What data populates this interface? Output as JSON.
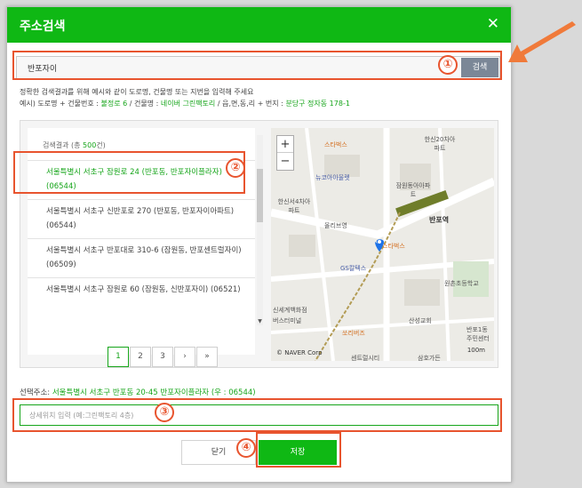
{
  "header": {
    "title": "주소검색",
    "close_label": "✕"
  },
  "search": {
    "value": "반포자이",
    "button_label": "검색"
  },
  "hints": {
    "line1": "정확한 검색결과를 위해 예시와 같이 도로명, 건물명 또는 지번을 입력해 주세요",
    "line2_prefix": "예시) 도로명 + 건물번호 : ",
    "line2_ex1": "불정로 6",
    "line2_mid1": " / 건물명 : ",
    "line2_ex2": "네이버 그린팩토리",
    "line2_mid2": " / 읍,면,동,리 + 번지 : ",
    "line2_ex3": "분당구 정자동 178-1"
  },
  "results": {
    "count_prefix": "검색결과 (총 ",
    "count_value": "500",
    "count_suffix": "건)",
    "items": [
      {
        "text": "서울특별시 서초구 잠원로 24 (반포동, 반포자이플라자) (06544)"
      },
      {
        "text": "서울특별시 서초구 신반포로 270 (반포동, 반포자이아파트) (06544)"
      },
      {
        "text": "서울특별시 서초구 반포대로 310-6 (잠원동, 반포센트럴자이) (06509)"
      },
      {
        "text": "서울특별시 서초구 잠원로 60 (잠원동, 신반포자이) (06521)"
      }
    ]
  },
  "pagination": {
    "pages": [
      "1",
      "2",
      "3"
    ],
    "next": "›",
    "last": "»"
  },
  "map": {
    "zoom_in": "+",
    "zoom_out": "−",
    "labels": [
      "스타벅스",
      "한신20차아파트",
      "뉴코아아울렛",
      "잠원동아아파트",
      "한신서4차아파트",
      "올리브영",
      "반포역",
      "스타벅스",
      "GS칼텍스",
      "원촌초등학교",
      "신세계백화점",
      "버스터미널",
      "산성교회",
      "쏘리버즈",
      "반포1동주민센터",
      "삼호가든",
      "센트럴시티"
    ],
    "copyright": "© NAVER Corp",
    "scale": "100m"
  },
  "selected": {
    "prefix": "선택주소: ",
    "value": "서울특별시 서초구 반포동 20-45 반포자이플라자 (우 : 06544)"
  },
  "detail": {
    "placeholder": "상세위치 입력 (예:그린팩토리 4층)"
  },
  "buttons": {
    "close": "닫기",
    "save": "저장"
  },
  "annotations": {
    "n1": "①",
    "n2": "②",
    "n3": "③",
    "n4": "④",
    "color": "#e8542e"
  }
}
